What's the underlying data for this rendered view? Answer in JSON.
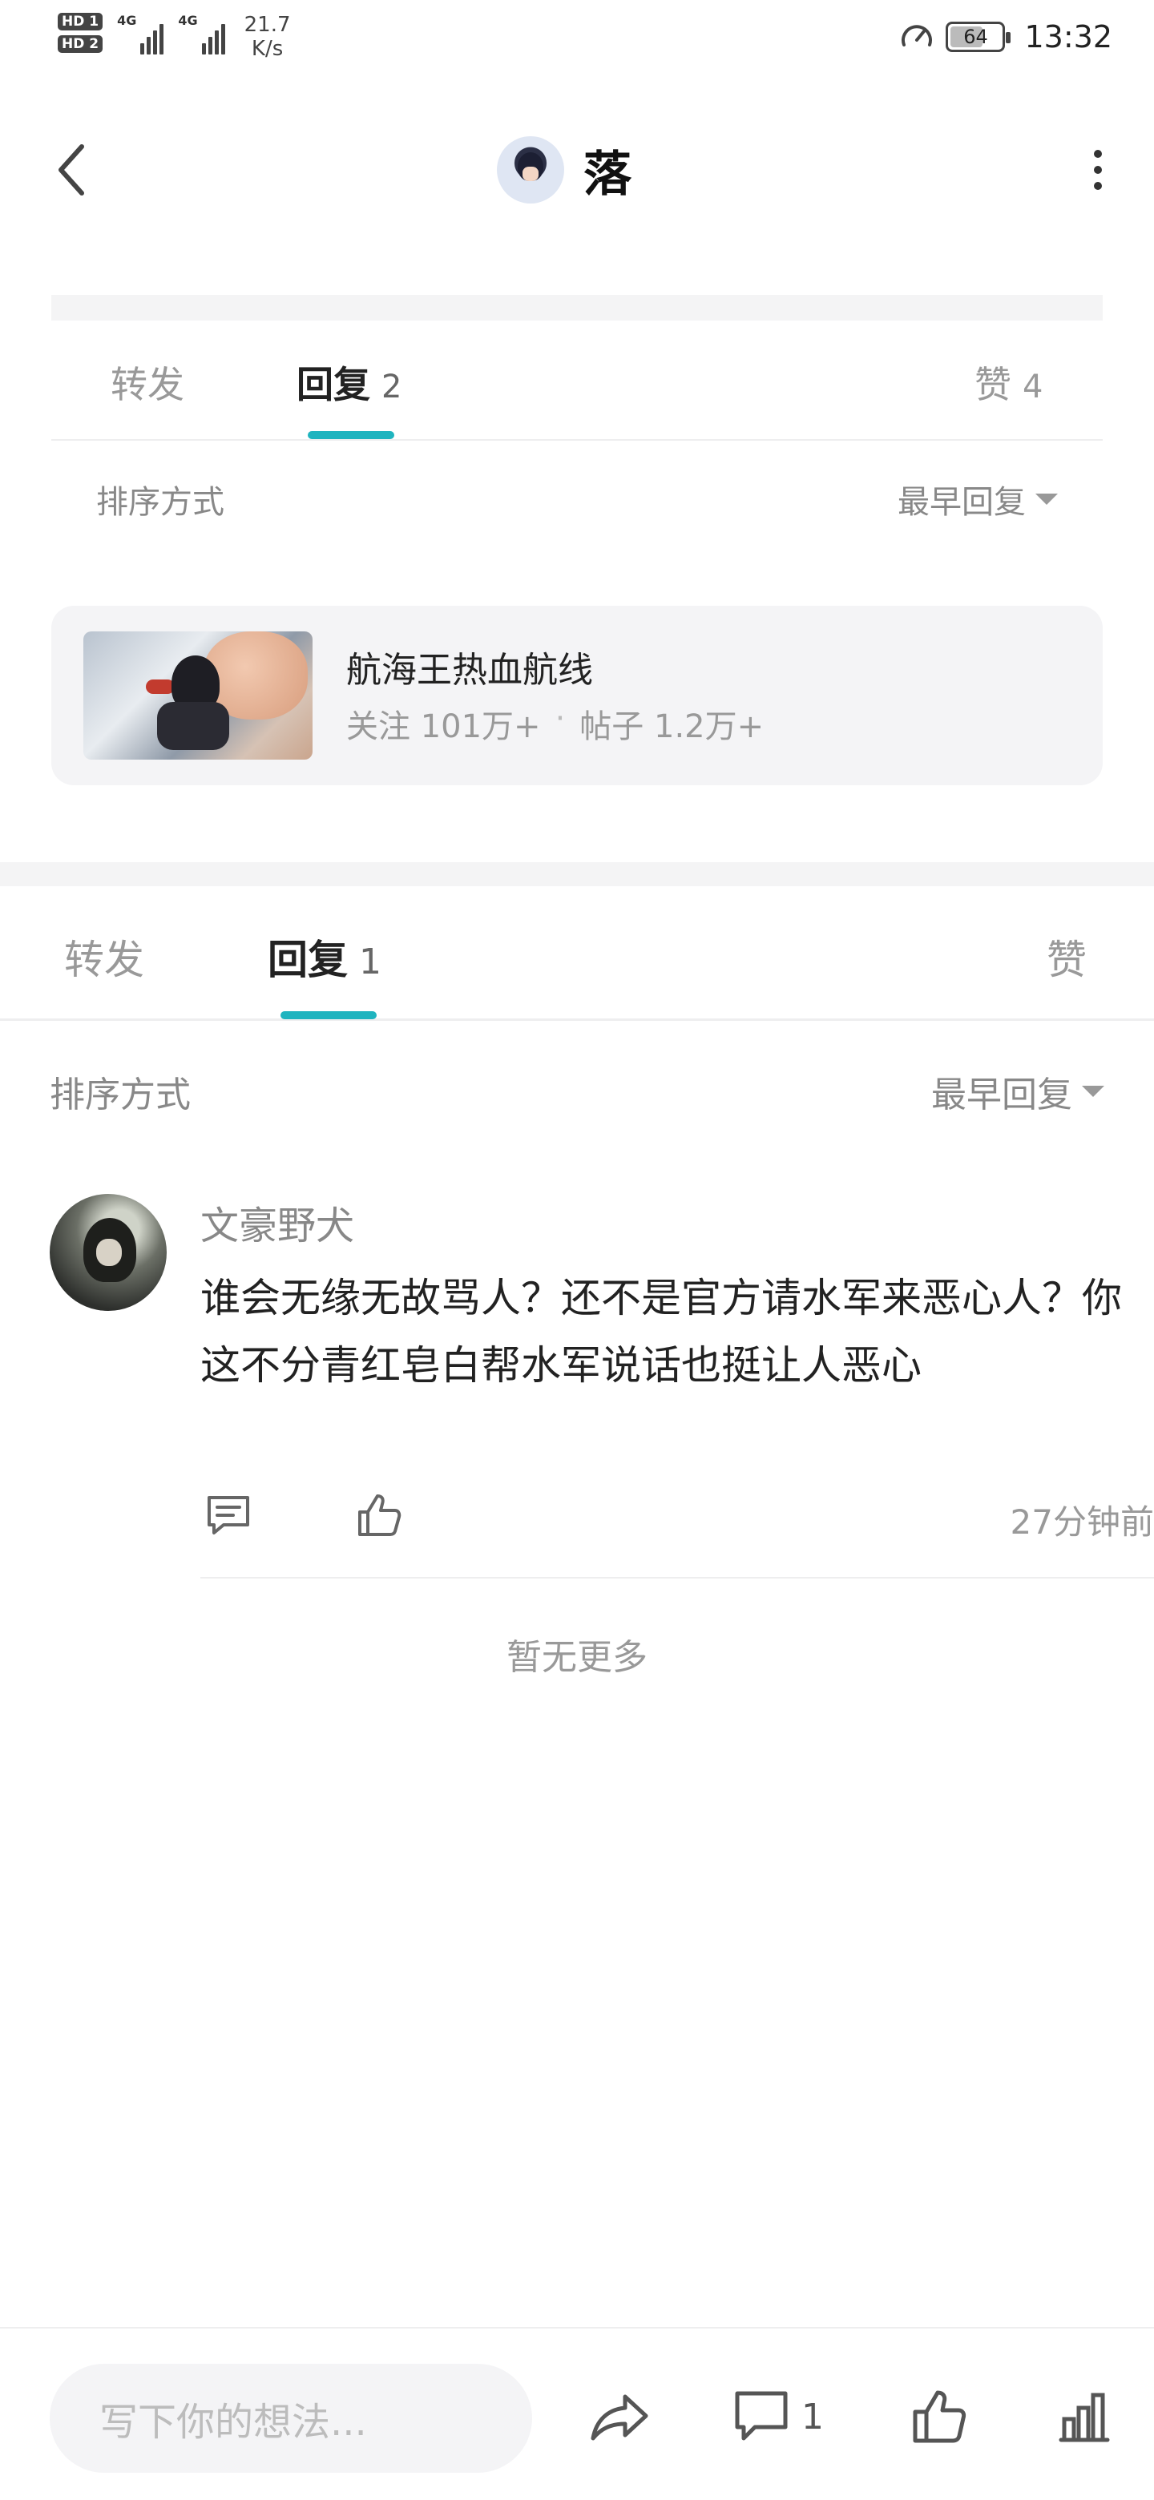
{
  "status_bar": {
    "hd1": "HD 1",
    "hd2": "HD 2",
    "sig1_label": "4G",
    "sig2_label": "4G",
    "speed_value": "21.7",
    "speed_unit": "K/s",
    "battery": "64",
    "battery_level": 0.64,
    "time": "13:32"
  },
  "header": {
    "title": "落",
    "back_icon": "chevron-left-icon",
    "more_icon": "more-vertical-icon"
  },
  "upper_layer": {
    "tabs": [
      {
        "label": "转发",
        "count": ""
      },
      {
        "label": "回复",
        "count": "2"
      },
      {
        "label": "赞",
        "count": "4"
      }
    ],
    "active_tab": 1,
    "sort_label": "排序方式",
    "sort_value": "最早回复",
    "forum": {
      "name": "航海王热血航线",
      "follow": "关注 101万+",
      "separator": "·",
      "posts": "帖子 1.2万+"
    }
  },
  "lower_layer": {
    "tabs": [
      {
        "label": "转发",
        "count": ""
      },
      {
        "label": "回复",
        "count": "1"
      },
      {
        "label": "赞",
        "count": ""
      }
    ],
    "active_tab": 1,
    "sort_label": "排序方式",
    "sort_value": "最早回复"
  },
  "comment": {
    "user": "文豪野犬",
    "text": "谁会无缘无故骂人？还不是官方请水军来恶心人？你这不分青红皂白帮水军说话也挺让人恶心",
    "time": "27分钟前"
  },
  "no_more": "暂无更多",
  "bottom_bar": {
    "placeholder": "写下你的想法...",
    "comment_count": "1"
  },
  "colors": {
    "accent": "#1fb4bf",
    "text_primary": "#222222",
    "text_secondary": "#999999",
    "card_bg": "#f4f4f6"
  }
}
